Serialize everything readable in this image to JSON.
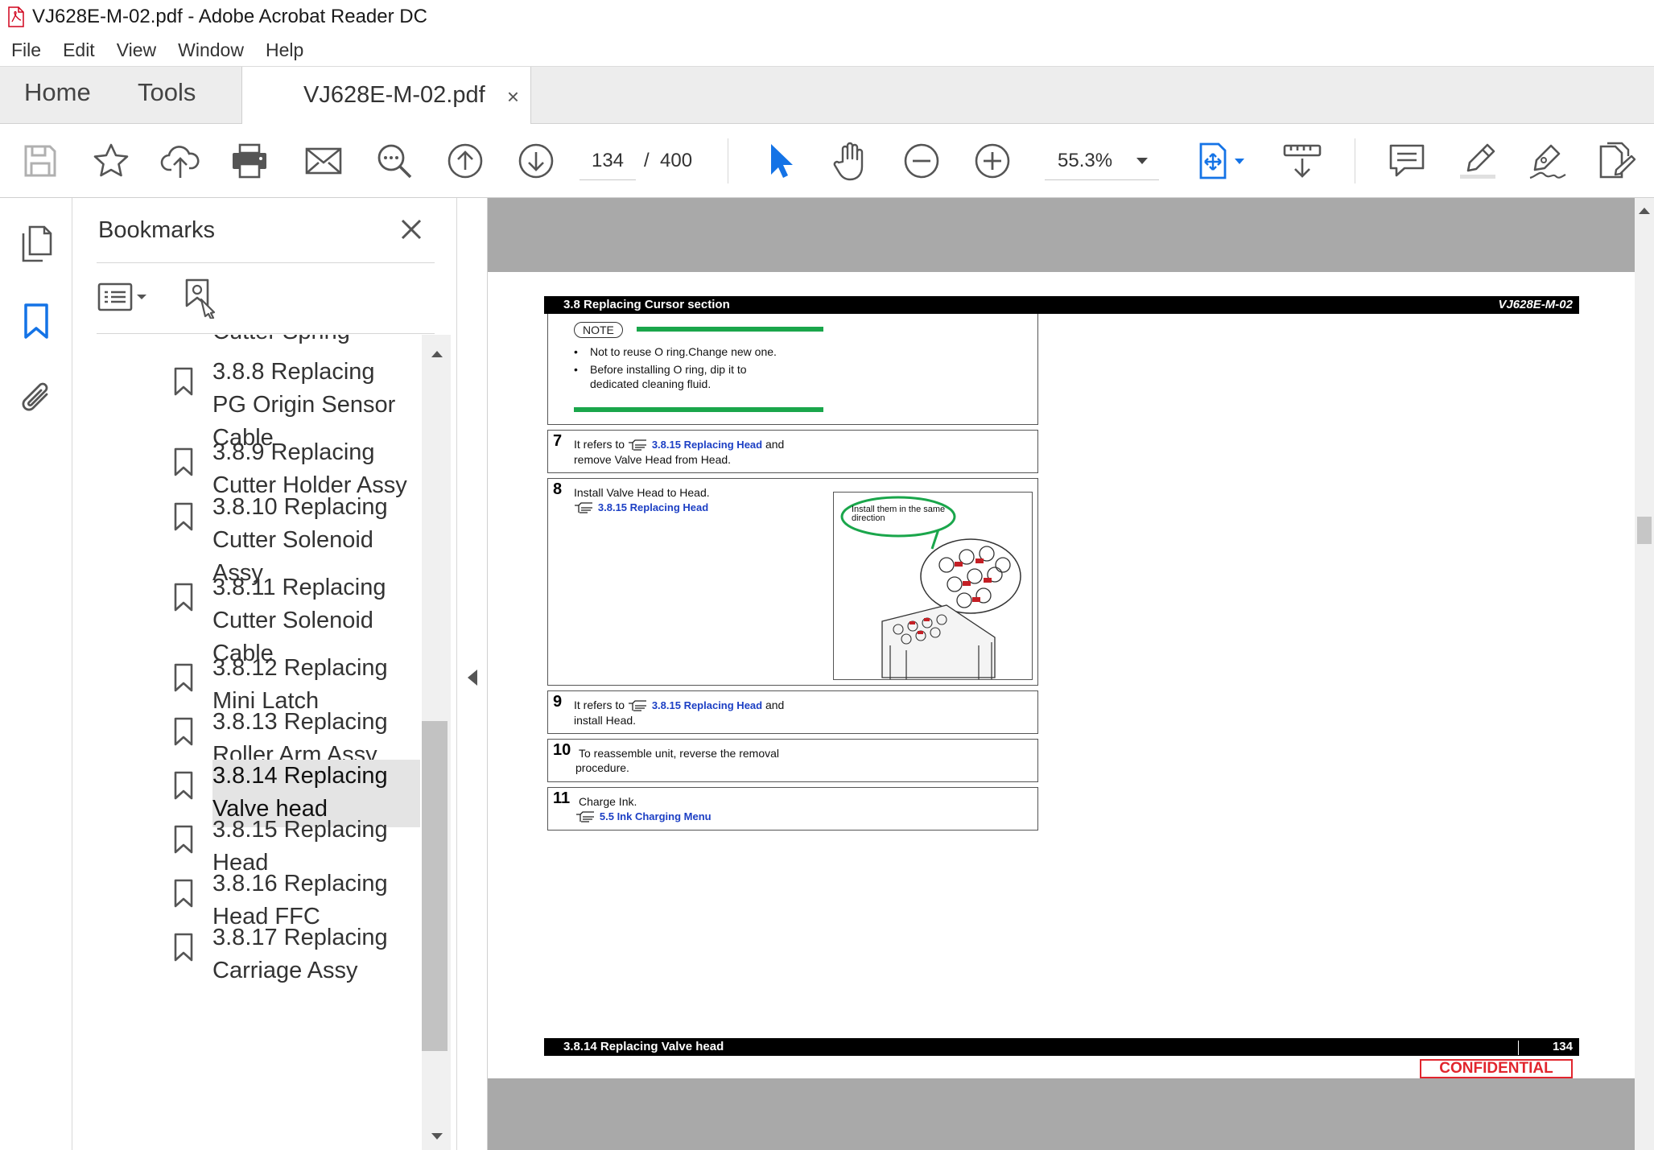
{
  "window": {
    "title": "VJ628E-M-02.pdf - Adobe Acrobat Reader DC"
  },
  "menu": [
    "File",
    "Edit",
    "View",
    "Window",
    "Help"
  ],
  "tabs": {
    "home": "Home",
    "tools": "Tools",
    "document": "VJ628E-M-02.pdf",
    "close": "×"
  },
  "toolbar": {
    "page_current": "134",
    "page_sep": "/",
    "page_total": "400",
    "zoom": "55.3%"
  },
  "bookmarks": {
    "title": "Bookmarks",
    "close": "×",
    "items": [
      {
        "label": "Cutter Spring"
      },
      {
        "label": "3.8.8 Replacing PG Origin Sensor Cable"
      },
      {
        "label": "3.8.9 Replacing Cutter Holder Assy"
      },
      {
        "label": "3.8.10 Replacing Cutter Solenoid Assy"
      },
      {
        "label": "3.8.11 Replacing Cutter Solenoid Cable"
      },
      {
        "label": "3.8.12 Replacing Mini Latch"
      },
      {
        "label": "3.8.13 Replacing Roller Arm Assy"
      },
      {
        "label": "3.8.14 Replacing Valve head",
        "selected": true
      },
      {
        "label": "3.8.15 Replacing Head"
      },
      {
        "label": "3.8.16 Replacing Head FFC"
      },
      {
        "label": "3.8.17 Replacing Carriage Assy"
      }
    ]
  },
  "pdf": {
    "header_left": "3.8 Replacing Cursor section",
    "header_right": "VJ628E-M-02",
    "note_label": "NOTE",
    "note_items": [
      "Not to reuse O ring.Change new one.",
      "Before installing O ring, dip it to dedicated cleaning fluid."
    ],
    "steps": [
      {
        "num": "7",
        "pre": "It refers to",
        "link": "3.8.15 Replacing Head",
        "post": "and",
        "line2": "remove Valve Head from Head."
      },
      {
        "num": "8",
        "text": "Install Valve Head to Head.",
        "link": "3.8.15 Replacing Head",
        "callout": "Install them in the same direction"
      },
      {
        "num": "9",
        "pre": "It refers to",
        "link": "3.8.15 Replacing Head",
        "post": "and",
        "line2": "install Head."
      },
      {
        "num": "10",
        "text": "To reassemble unit, reverse the removal",
        "line2": "procedure."
      },
      {
        "num": "11",
        "text": "Charge Ink.",
        "link": "5.5 Ink Charging Menu"
      }
    ],
    "footer_left": "3.8.14 Replacing Valve head",
    "footer_page": "134",
    "confidential": "CONFIDENTIAL"
  },
  "colors": {
    "accent_blue": "#1473e6",
    "note_green": "#1aa64b",
    "confidential_red": "#e1252d",
    "link_blue": "#1c3fc4"
  }
}
